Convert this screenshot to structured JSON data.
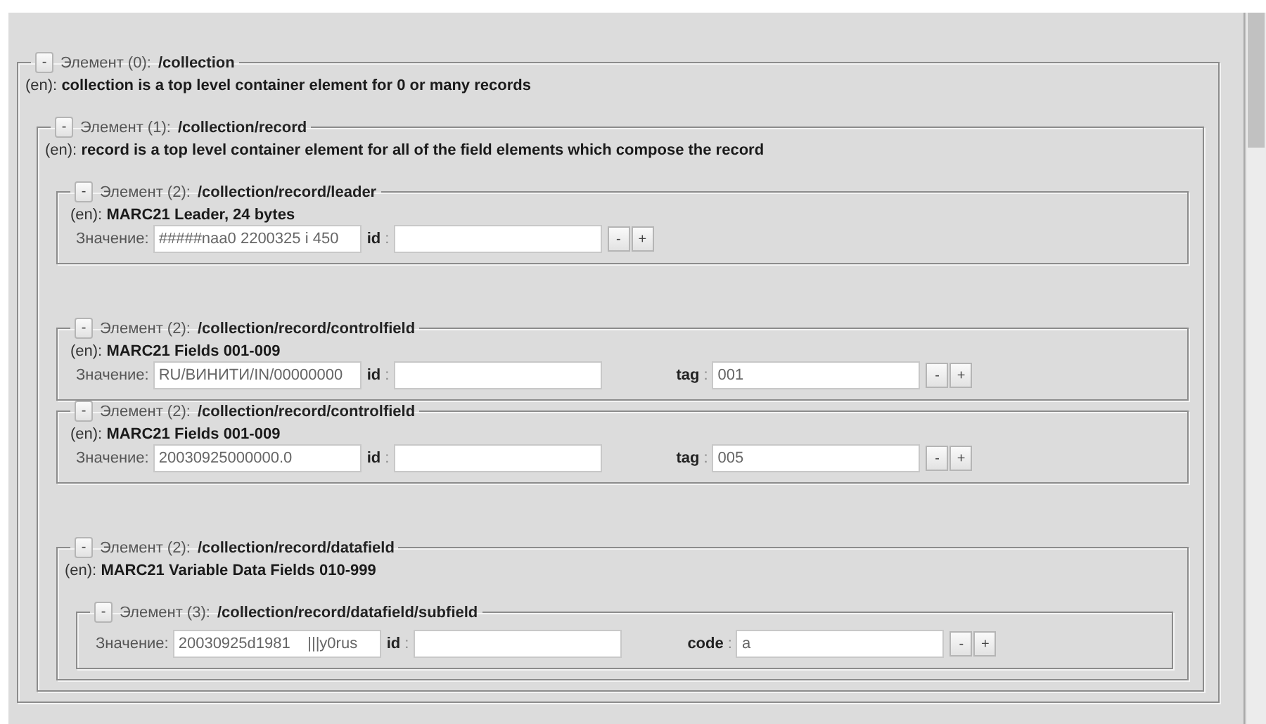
{
  "elements": [
    {
      "toggle": "-",
      "label": "Элемент (0):",
      "path": "/collection",
      "description_prefix": "(en):",
      "description": "collection is a top level container element for 0 or many records",
      "child_groups": [
        [
          {
            "toggle": "-",
            "label": "Элемент (1):",
            "path": "/collection/record",
            "description_prefix": "(en):",
            "description": "record is a top level container element for all of the field elements which compose the record",
            "child_groups": [
              [
                {
                  "toggle": "-",
                  "label": "Элемент (2):",
                  "path": "/collection/record/leader",
                  "description_prefix": "(en):",
                  "description": "MARC21 Leader, 24 bytes",
                  "value_label": "Значение:",
                  "value": "#####naa0 2200325 i 450",
                  "attributes": [
                    {
                      "name": "id",
                      "separator": ":"
                    }
                  ],
                  "buttons": [
                    "-",
                    "+"
                  ]
                }
              ],
              [
                {
                  "toggle": "-",
                  "label": "Элемент (2):",
                  "path": "/collection/record/controlfield",
                  "description_prefix": "(en):",
                  "description": "MARC21 Fields 001-009",
                  "value_label": "Значение:",
                  "value": "RU/ВИНИТИ/IN/00000000",
                  "attributes": [
                    {
                      "name": "id",
                      "separator": ":"
                    },
                    {
                      "name": "tag",
                      "separator": ":",
                      "value": "001"
                    }
                  ],
                  "buttons": [
                    "-",
                    "+"
                  ]
                },
                {
                  "toggle": "-",
                  "label": "Элемент (2):",
                  "path": "/collection/record/controlfield",
                  "description_prefix": "(en):",
                  "description": "MARC21 Fields 001-009",
                  "value_label": "Значение:",
                  "value": "20030925000000.0",
                  "attributes": [
                    {
                      "name": "id",
                      "separator": ":"
                    },
                    {
                      "name": "tag",
                      "separator": ":",
                      "value": "005"
                    }
                  ],
                  "buttons": [
                    "-",
                    "+"
                  ]
                }
              ],
              [
                {
                  "toggle": "-",
                  "label": "Элемент (2):",
                  "path": "/collection/record/datafield",
                  "description_prefix": "(en):",
                  "description": "MARC21 Variable Data Fields 010-999",
                  "child_groups": [
                    [
                      {
                        "toggle": "-",
                        "label": "Элемент (3):",
                        "path": "/collection/record/datafield/subfield",
                        "value_label": "Значение:",
                        "value": "20030925d1981    |||y0rus",
                        "attributes": [
                          {
                            "name": "id",
                            "separator": ":"
                          },
                          {
                            "name": "code",
                            "separator": ":",
                            "value": "a"
                          }
                        ],
                        "buttons": [
                          "-",
                          "+"
                        ]
                      }
                    ]
                  ]
                }
              ]
            ]
          }
        ]
      ]
    }
  ]
}
